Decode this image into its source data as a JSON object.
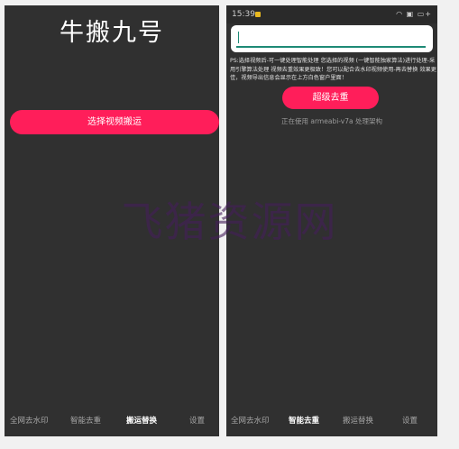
{
  "left_screen": {
    "title": "牛搬九号",
    "select_video_button": "选择视频搬运",
    "nav": [
      "全网去水印",
      "智能去重",
      "搬运替换",
      "设置"
    ],
    "active_nav": "搬运替换"
  },
  "right_screen": {
    "status_bar": {
      "time": "15:39",
      "icons": "◠ ▣ ▭+"
    },
    "input": {
      "value": "",
      "placeholder": ""
    },
    "ps_text": "PS:选择视频后-可一键处理智能处理 您选择的视频 (一键智能独家算法)进行处理-采用引擎算法处理 视频去重效果更极致！您可以配合去水印视频使用-再去替换 效果更佳，视频导出信息会显示在上方白色窗户里面！",
    "super_dedup_button": "超级去重",
    "arch_text": "正在使用 armeabi-v7a 处理架构",
    "nav": [
      "全网去水印",
      "智能去重",
      "搬运替换",
      "设置"
    ],
    "active_nav": "智能去重"
  },
  "watermark": "飞猪资源网",
  "colors": {
    "accent": "#ff1e5a",
    "background": "#303030",
    "input_underline": "#1e8a76"
  }
}
